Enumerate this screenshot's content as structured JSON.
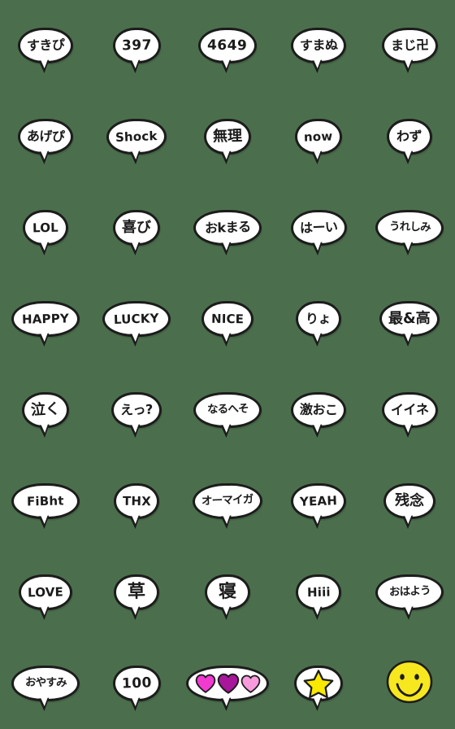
{
  "sheet": {
    "title": "Handwritten speech bubble emoji sheet",
    "background_color": "#4b6f4c",
    "bubble_fill": "#ffffff",
    "bubble_outline": "#1c1c1c",
    "text_color": "#1b1b1b",
    "columns": 5,
    "rows": 8
  },
  "palette": {
    "star_yellow": "#f9e900",
    "smiley_yellow": "#f7e71e",
    "heart_pink": "#f03ad0",
    "heart_magenta": "#a8169b",
    "heart_light_pink": "#f79bdd",
    "outline_black": "#1c1c1c"
  },
  "stickers": [
    {
      "id": 1,
      "text": "すきぴ",
      "kind": "bubble",
      "style": "jp",
      "width": "normal"
    },
    {
      "id": 2,
      "text": "397",
      "kind": "bubble",
      "style": "num",
      "width": "narrow"
    },
    {
      "id": 3,
      "text": "4649",
      "kind": "bubble",
      "style": "num",
      "width": "normal"
    },
    {
      "id": 4,
      "text": "すまぬ",
      "kind": "bubble",
      "style": "jp",
      "width": "normal"
    },
    {
      "id": 5,
      "text": "まじ卍",
      "kind": "bubble",
      "style": "jp",
      "width": "normal"
    },
    {
      "id": 6,
      "text": "あげぴ",
      "kind": "bubble",
      "style": "jp",
      "width": "normal"
    },
    {
      "id": 7,
      "text": "Shock",
      "kind": "bubble",
      "style": "lat",
      "width": "normal"
    },
    {
      "id": 8,
      "text": "無理",
      "kind": "bubble",
      "style": "kan",
      "width": "narrow"
    },
    {
      "id": 9,
      "text": "now",
      "kind": "bubble",
      "style": "lat",
      "width": "narrow"
    },
    {
      "id": 10,
      "text": "わず",
      "kind": "bubble",
      "style": "jp",
      "width": "narrow"
    },
    {
      "id": 11,
      "text": "LOL",
      "kind": "bubble",
      "style": "lat",
      "width": "narrow"
    },
    {
      "id": 12,
      "text": "喜び",
      "kind": "bubble",
      "style": "kan",
      "width": "narrow"
    },
    {
      "id": 13,
      "text": "おkまる",
      "kind": "bubble",
      "style": "jp",
      "width": "wide"
    },
    {
      "id": 14,
      "text": "はーい",
      "kind": "bubble",
      "style": "jp",
      "width": "normal"
    },
    {
      "id": 15,
      "text": "うれしみ",
      "kind": "bubble",
      "style": "small",
      "width": "wide"
    },
    {
      "id": 16,
      "text": "HAPPY",
      "kind": "bubble",
      "style": "lat",
      "width": "wide"
    },
    {
      "id": 17,
      "text": "LUCKY",
      "kind": "bubble",
      "style": "lat",
      "width": "wide"
    },
    {
      "id": 18,
      "text": "NICE",
      "kind": "bubble",
      "style": "lat",
      "width": "normal"
    },
    {
      "id": 19,
      "text": "りょ",
      "kind": "bubble",
      "style": "jp",
      "width": "narrow"
    },
    {
      "id": 20,
      "text": "最&高",
      "kind": "bubble",
      "style": "kan",
      "width": "normal"
    },
    {
      "id": 21,
      "text": "泣く",
      "kind": "bubble",
      "style": "kan",
      "width": "narrow"
    },
    {
      "id": 22,
      "text": "えっ?",
      "kind": "bubble",
      "style": "jp",
      "width": "narrow"
    },
    {
      "id": 23,
      "text": "なるへそ",
      "kind": "bubble",
      "style": "small",
      "width": "wide"
    },
    {
      "id": 24,
      "text": "激おこ",
      "kind": "bubble",
      "style": "jp",
      "width": "normal"
    },
    {
      "id": 25,
      "text": "イイネ",
      "kind": "bubble",
      "style": "jp",
      "width": "normal"
    },
    {
      "id": 26,
      "text": "FiBht",
      "kind": "bubble",
      "style": "lat",
      "width": "wide"
    },
    {
      "id": 27,
      "text": "THX",
      "kind": "bubble",
      "style": "lat",
      "width": "narrow"
    },
    {
      "id": 28,
      "text": "オーマイガ",
      "kind": "bubble",
      "style": "small",
      "width": "wide"
    },
    {
      "id": 29,
      "text": "YEAH",
      "kind": "bubble",
      "style": "lat",
      "width": "normal"
    },
    {
      "id": 30,
      "text": "残念",
      "kind": "bubble",
      "style": "kan",
      "width": "normal"
    },
    {
      "id": 31,
      "text": "LOVE",
      "kind": "bubble",
      "style": "lat",
      "width": "normal"
    },
    {
      "id": 32,
      "text": "草",
      "kind": "bubble",
      "style": "big",
      "width": "narrow"
    },
    {
      "id": 33,
      "text": "寝",
      "kind": "bubble",
      "style": "big",
      "width": "narrow"
    },
    {
      "id": 34,
      "text": "Hiii",
      "kind": "bubble",
      "style": "lat",
      "width": "narrow"
    },
    {
      "id": 35,
      "text": "おはよう",
      "kind": "bubble",
      "style": "small",
      "width": "wide"
    },
    {
      "id": 36,
      "text": "おやすみ",
      "kind": "bubble",
      "style": "small",
      "width": "wide"
    },
    {
      "id": 37,
      "text": "100",
      "kind": "bubble",
      "style": "num",
      "width": "narrow"
    },
    {
      "id": 38,
      "text": "",
      "kind": "hearts",
      "style": "",
      "width": "normal",
      "icon": "three-hearts-icon",
      "heart_colors": [
        "#f03ad0",
        "#a8169b",
        "#f79bdd"
      ]
    },
    {
      "id": 39,
      "text": "",
      "kind": "star",
      "style": "",
      "width": "narrow",
      "icon": "star-icon",
      "color": "#f9e900"
    },
    {
      "id": 40,
      "text": "",
      "kind": "smiley",
      "style": "",
      "width": "normal",
      "icon": "smiley-face-icon",
      "color": "#f7e71e"
    }
  ]
}
